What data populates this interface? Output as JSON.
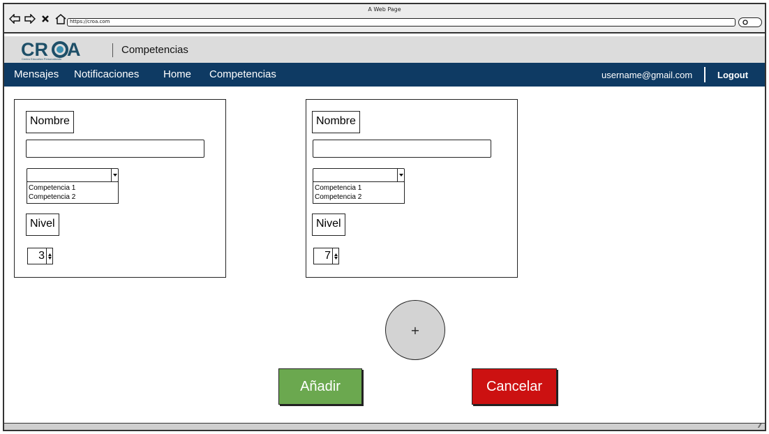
{
  "window": {
    "title": "A Web Page"
  },
  "browser": {
    "url": "https://croa.com"
  },
  "header": {
    "logo_text": "CROA",
    "logo_tagline": "Centro Educativo Personalizado",
    "page_title": "Competencias"
  },
  "nav": {
    "items": [
      {
        "label": "Mensajes"
      },
      {
        "label": "Notificaciones"
      },
      {
        "label": "Home"
      },
      {
        "label": "Competencias"
      }
    ],
    "username": "username@gmail.com",
    "logout": "Logout"
  },
  "cards": [
    {
      "name_label": "Nombre",
      "name_value": "",
      "select_value": "",
      "options": [
        "Competencia 1",
        "Competencia 2"
      ],
      "level_label": "Nivel",
      "level_value": "3"
    },
    {
      "name_label": "Nombre",
      "name_value": "",
      "select_value": "",
      "options": [
        "Competencia 1",
        "Competencia 2"
      ],
      "level_label": "Nivel",
      "level_value": "7"
    }
  ],
  "add_circle": {
    "symbol": "+"
  },
  "buttons": {
    "add": "Añadir",
    "cancel": "Cancelar"
  },
  "colors": {
    "navbar": "#0e3a63",
    "add_button": "#6ba84f",
    "cancel_button": "#cc1111",
    "logo": "#1e4f68"
  }
}
